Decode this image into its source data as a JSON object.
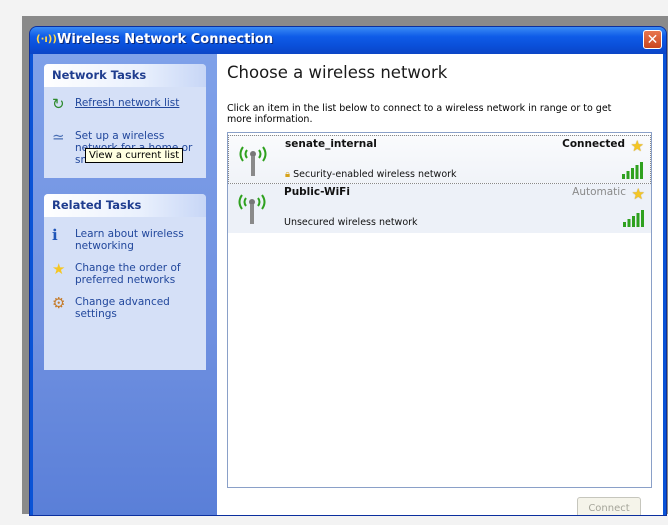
{
  "window": {
    "title_icon": "(·ı))",
    "title": "Wireless Network Connection",
    "close_glyph": "✕"
  },
  "sidebar": {
    "network_tasks": {
      "heading": "Network Tasks",
      "items": [
        {
          "label": "Refresh network list",
          "icon": "refresh-icon"
        },
        {
          "label": "Set up a wireless network for a home or small office",
          "icon": "setup-wireless-icon"
        }
      ]
    },
    "tooltip": "View a current list",
    "related_tasks": {
      "heading": "Related Tasks",
      "items": [
        {
          "label": "Learn about wireless networking",
          "icon": "info-icon"
        },
        {
          "label": "Change the order of preferred networks",
          "icon": "star-icon"
        },
        {
          "label": "Change advanced settings",
          "icon": "settings-icon"
        }
      ]
    }
  },
  "main": {
    "title": "Choose a wireless network",
    "instructions": "Click an item in the list below to connect to a wireless network in range or to get more information.",
    "networks": [
      {
        "ssid": "senate_internal",
        "status": "Connected",
        "security": "Security-enabled wireless network",
        "signal_bars": 5,
        "selected": true,
        "status_color": "#111111"
      },
      {
        "ssid": "Public-WiFi",
        "status": "Automatic",
        "security": "Unsecured wireless network",
        "signal_bars": 5,
        "selected": false,
        "status_color": "#8a8a8a"
      }
    ],
    "connect_button": "Connect"
  },
  "colors": {
    "titlebar": "#0a53d6",
    "signal_green": "#2fa11f",
    "star_gold": "#f5c623"
  }
}
